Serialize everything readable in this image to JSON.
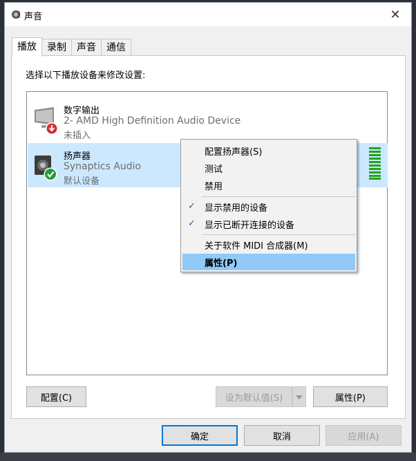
{
  "window": {
    "title": "声音",
    "close_glyph": "✕"
  },
  "tabs": [
    {
      "label": "播放",
      "active": true
    },
    {
      "label": "录制",
      "active": false
    },
    {
      "label": "声音",
      "active": false
    },
    {
      "label": "通信",
      "active": false
    }
  ],
  "instruction": "选择以下播放设备来修改设置:",
  "devices": [
    {
      "name": "数字输出",
      "subtitle": "2- AMD High Definition Audio Device",
      "status": "未插入",
      "icon": "monitor-icon",
      "badge": "unplugged-badge-icon",
      "selected": false
    },
    {
      "name": "扬声器",
      "subtitle": "Synaptics Audio",
      "status": "默认设备",
      "icon": "speaker-icon",
      "badge": "default-check-badge-icon",
      "selected": true
    }
  ],
  "context_menu": {
    "items": [
      {
        "label": "配置扬声器(S)",
        "checked": false
      },
      {
        "label": "测试",
        "checked": false
      },
      {
        "label": "禁用",
        "checked": false
      },
      {
        "label": "显示禁用的设备",
        "checked": true
      },
      {
        "label": "显示已断开连接的设备",
        "checked": true
      },
      {
        "label": "关于软件 MIDI 合成器(M)",
        "checked": false
      },
      {
        "label": "属性(P)",
        "checked": false,
        "highlighted": true
      }
    ],
    "check_glyph": "✓"
  },
  "panel_buttons": {
    "configure": "配置(C)",
    "set_default": "设为默认值(S)",
    "properties": "属性(P)"
  },
  "dialog_buttons": {
    "ok": "确定",
    "cancel": "取消",
    "apply": "应用(A)"
  },
  "colors": {
    "selection": "#cce8ff",
    "menu_highlight": "#91c9f7",
    "accent": "#0078d7",
    "level_meter": "#1fa31f",
    "default_badge": "#1f9d3c",
    "unplugged_badge": "#d32f2f"
  }
}
